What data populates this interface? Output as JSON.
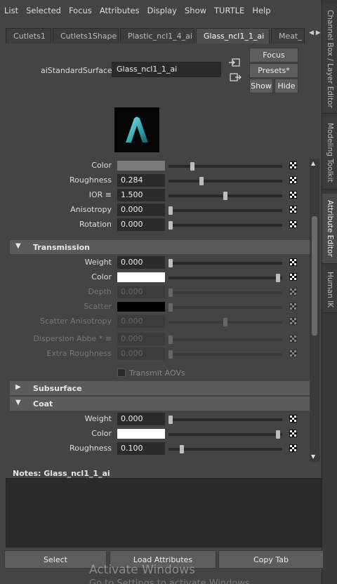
{
  "menu": [
    "List",
    "Selected",
    "Focus",
    "Attributes",
    "Display",
    "Show",
    "TURTLE",
    "Help"
  ],
  "side_tabs": [
    "Channel Box / Layer Editor",
    "Modeling Toolkit",
    "Attribute Editor",
    "Human IK"
  ],
  "tabs": [
    {
      "label": "Cutlets1"
    },
    {
      "label": "Cutlets1Shape"
    },
    {
      "label": "Plastic_ncl1_4_ai"
    },
    {
      "label": "Glass_ncl1_1_ai"
    },
    {
      "label": "Meat_"
    }
  ],
  "tab_arrows": "◀ ▶",
  "shader": {
    "label": "aiStandardSurface:",
    "value": "Glass_ncl1_1_ai"
  },
  "buttons": {
    "focus": "Focus",
    "presets": "Presets*",
    "show": "Show",
    "hide": "Hide"
  },
  "rows_top": [
    {
      "label": "Color",
      "value": "",
      "slider": 0.2,
      "color": "#7a7a7a"
    },
    {
      "label": "Roughness",
      "value": "0.284",
      "slider": 0.28
    },
    {
      "label": "IOR ≡",
      "value": "1.500",
      "slider": 0.5
    },
    {
      "label": "Anisotropy",
      "value": "0.000",
      "slider": 0.0
    },
    {
      "label": "Rotation",
      "value": "0.000",
      "slider": 0.0
    }
  ],
  "sections": {
    "transmission": "Transmission",
    "subsurface": "Subsurface",
    "coat": "Coat"
  },
  "transmission_rows": [
    {
      "label": "Weight",
      "value": "0.000",
      "slider": 0.0
    },
    {
      "label": "Color",
      "value": "",
      "slider": 0.98,
      "color": "#ffffff"
    },
    {
      "label": "Depth",
      "value": "0.000",
      "slider": 0.0
    },
    {
      "label": "Scatter",
      "value": "",
      "slider": 0.0,
      "color": "#000000"
    },
    {
      "label": "Scatter Anisotropy",
      "value": "0.000",
      "slider": 0.5
    },
    {
      "label": "Dispersion Abbe * ≡",
      "value": "0.000",
      "slider": 0.0
    },
    {
      "label": "Extra Roughness",
      "value": "0.000",
      "slider": 0.0
    }
  ],
  "transmit_aovs": "Transmit AOVs",
  "coat_rows": [
    {
      "label": "Weight",
      "value": "0.000",
      "slider": 0.0
    },
    {
      "label": "Color",
      "value": "",
      "slider": 0.98,
      "color": "#ffffff"
    },
    {
      "label": "Roughness",
      "value": "0.100",
      "slider": 0.1
    }
  ],
  "notes": {
    "label": "Notes:  Glass_ncl1_1_ai"
  },
  "bottom": {
    "select": "Select",
    "load": "Load Attributes",
    "copy": "Copy Tab"
  },
  "watermark": {
    "title": "Activate Windows",
    "sub": "Go to Settings to activate Windows."
  }
}
